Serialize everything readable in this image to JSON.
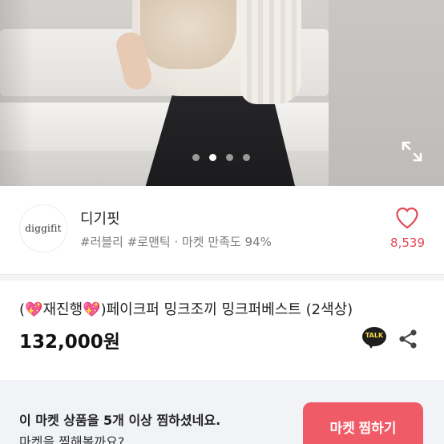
{
  "hero": {
    "carousel_total": 4,
    "carousel_active_index": 2,
    "expand_icon": "expand-icon"
  },
  "seller": {
    "logo_text": "diggifit",
    "name": "디기핏",
    "tags": "#러블리 #로맨틱 · 마켓 만족도 94%",
    "like_count": "8,539",
    "heart_icon": "heart-outline-icon",
    "accent_color": "#e04a57"
  },
  "product": {
    "title_prefix": "(",
    "sparkle_1": "💖",
    "title_middle": "재진행",
    "sparkle_2": "💖",
    "title_suffix": ")페이크퍼 밍크조끼 밍크퍼베스트 (2색상)",
    "price": "132,000원",
    "talk_label": "TALK",
    "share_icon": "share-icon"
  },
  "banner": {
    "line1": "이 마켓 상품을 5개 이상 찜하셨네요.",
    "line2": "마켓을 찜해볼까요?",
    "button_label": "마켓 찜하기",
    "button_color": "#ef5b66"
  }
}
